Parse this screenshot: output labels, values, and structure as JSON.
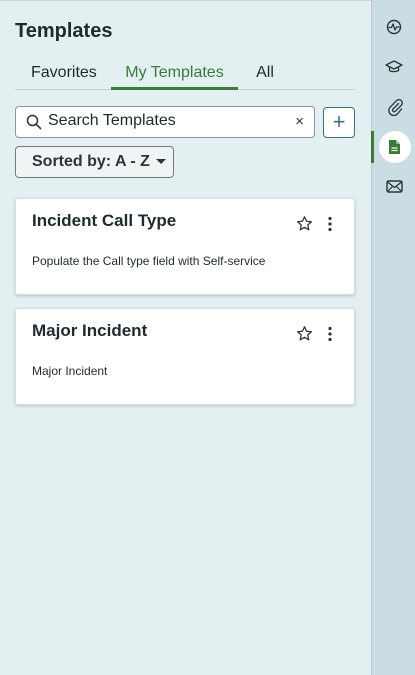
{
  "panel": {
    "title": "Templates",
    "tabs": [
      {
        "label": "Favorites"
      },
      {
        "label": "My Templates",
        "active": true
      },
      {
        "label": "All"
      }
    ],
    "search": {
      "placeholder": "Search Templates",
      "clear": "×"
    },
    "add_label": "+",
    "sort_label": "Sorted by: A - Z"
  },
  "cards": [
    {
      "title": "Incident Call Type",
      "description": "Populate the Call type field with Self-service"
    },
    {
      "title": "Major Incident",
      "description": "Major Incident"
    }
  ],
  "rail": {
    "items": [
      {
        "icon": "activity-icon"
      },
      {
        "icon": "graduation-cap-icon"
      },
      {
        "icon": "paperclip-icon"
      },
      {
        "icon": "document-icon",
        "active": true
      },
      {
        "icon": "email-icon"
      }
    ]
  },
  "colors": {
    "accent": "#3b7a3b",
    "panel_bg": "#e4eff1",
    "rail_bg": "#c9dde3"
  }
}
